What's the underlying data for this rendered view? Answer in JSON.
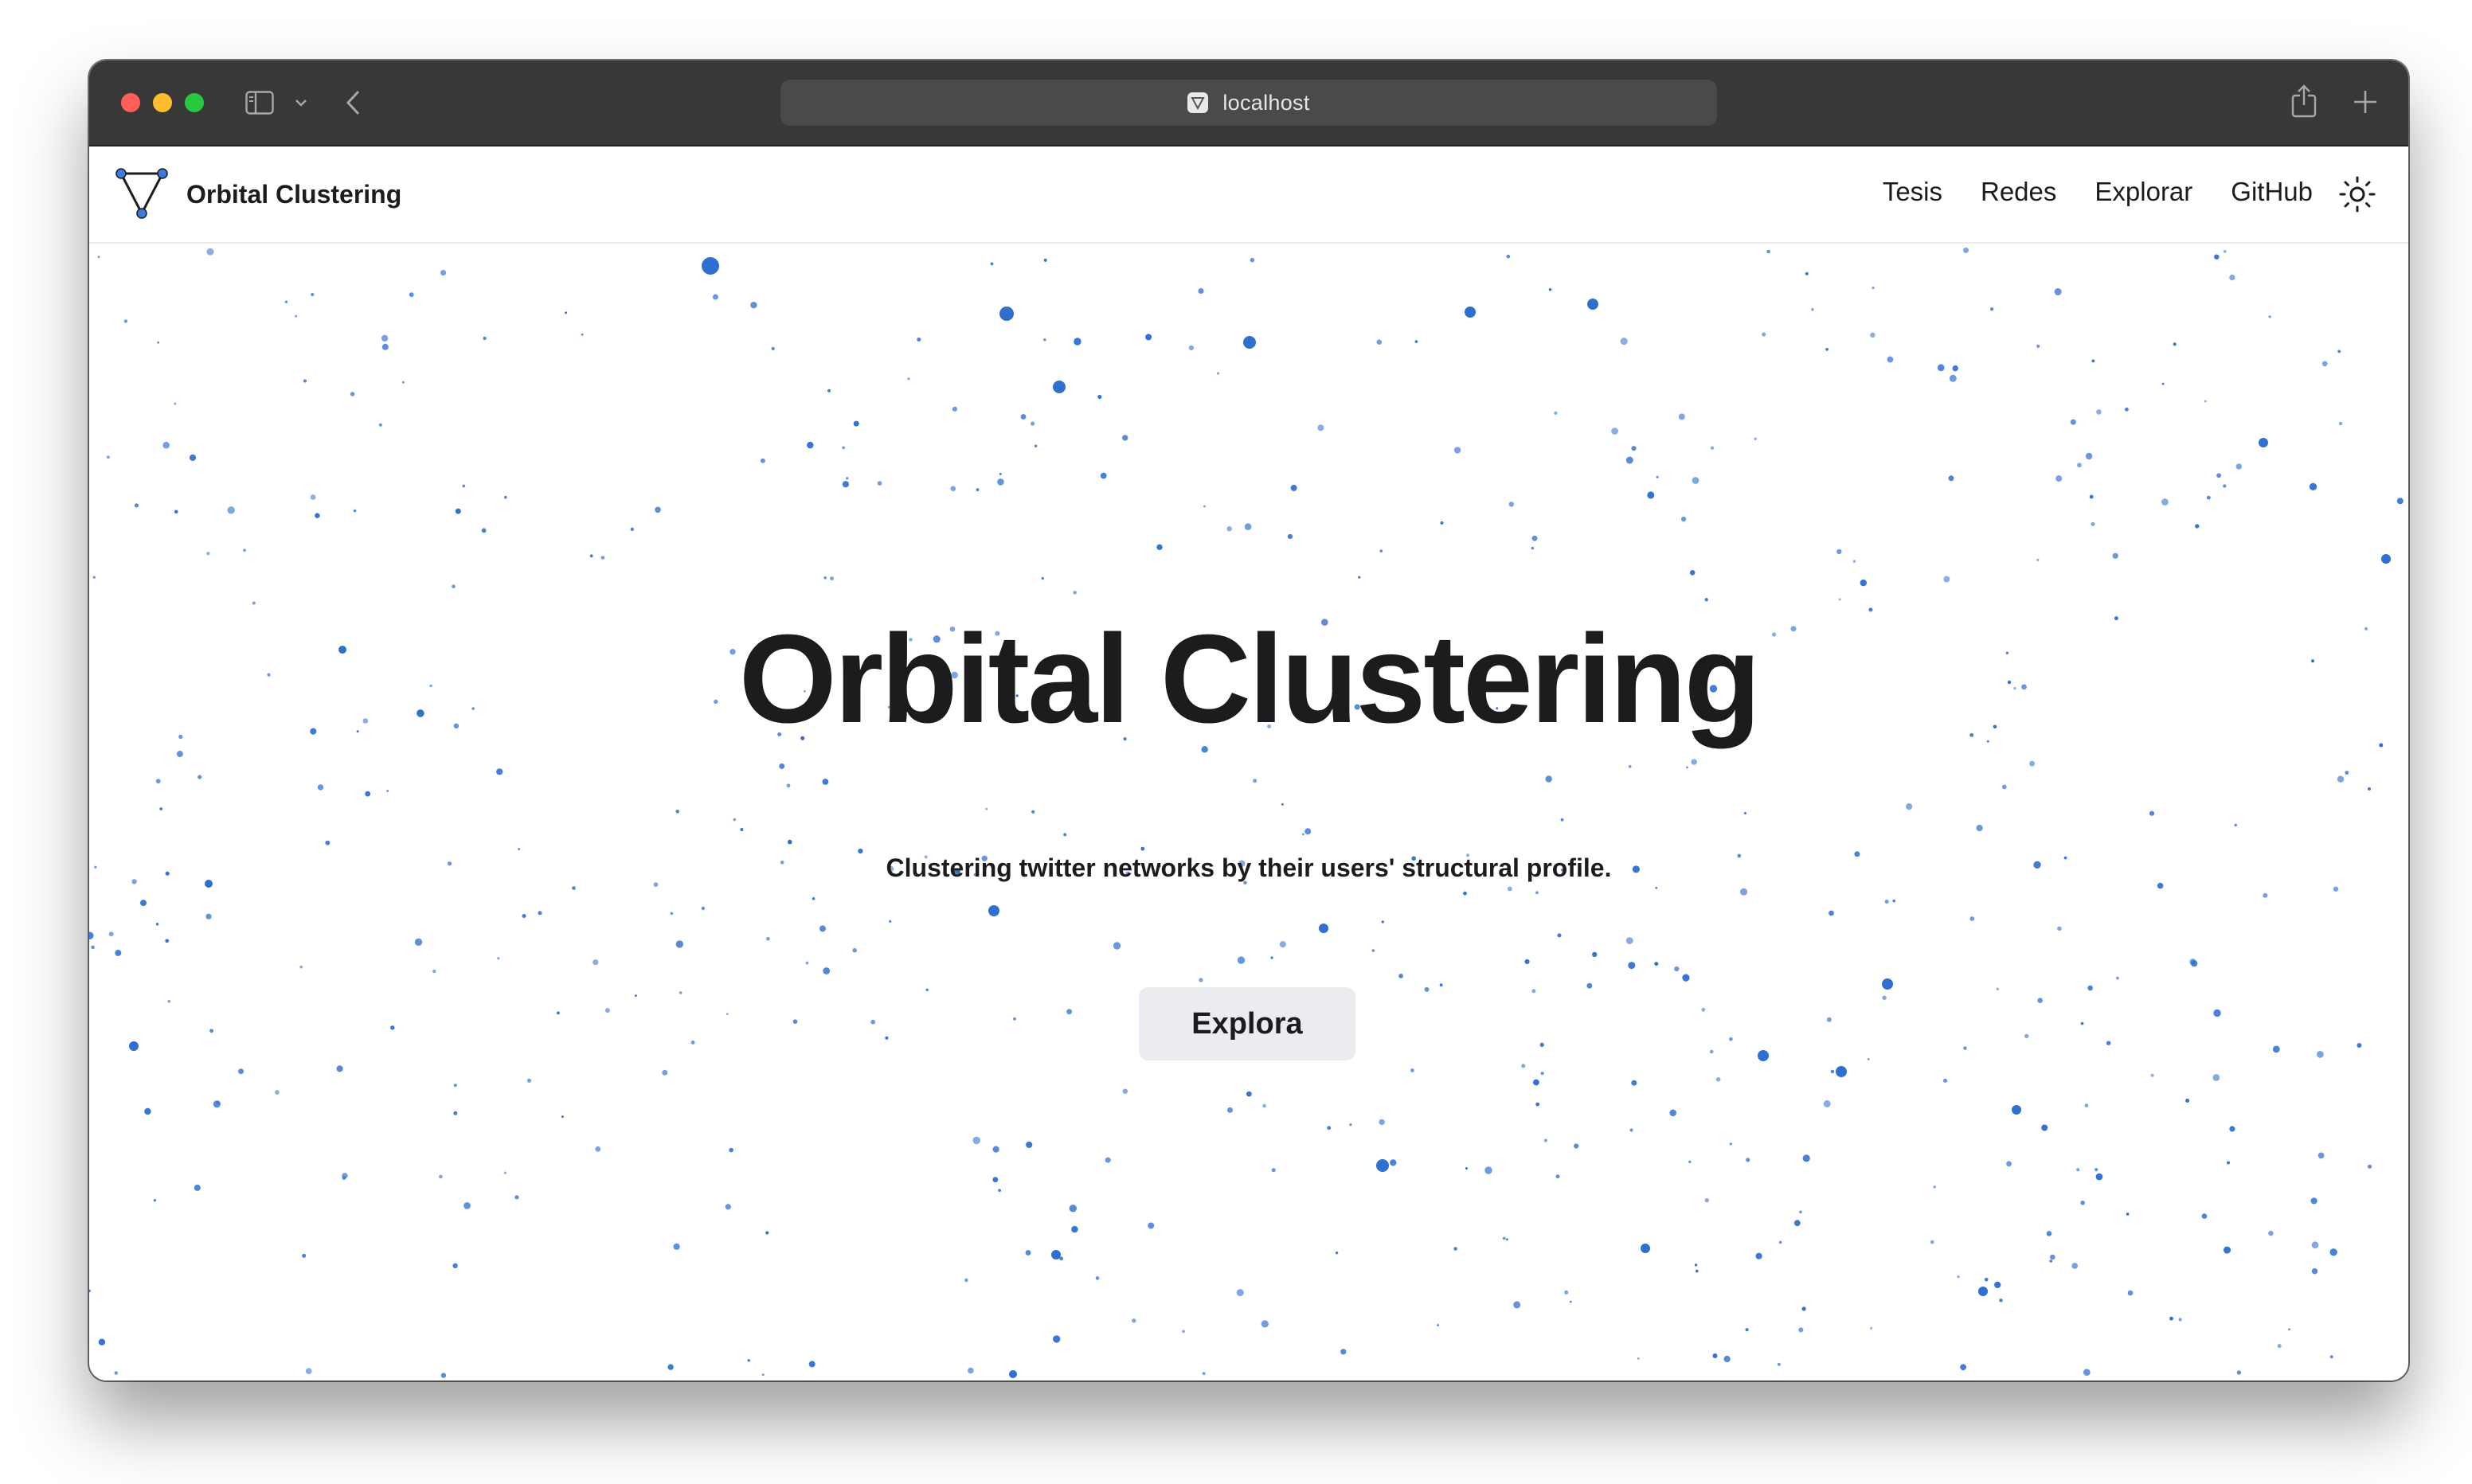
{
  "browser": {
    "url": "localhost"
  },
  "site": {
    "brand": "Orbital Clustering",
    "nav": [
      "Tesis",
      "Redes",
      "Explorar",
      "GitHub"
    ],
    "theme_icon": "sun-icon"
  },
  "hero": {
    "title": "Orbital Clustering",
    "subtitle": "Clustering twitter networks by their users' structural profile.",
    "cta_label": "Explora"
  },
  "colors": {
    "titlebar": "#383838",
    "accent_dots": "#2f6fcf",
    "text": "#1c1c1e",
    "button_bg": "#ebecf0"
  }
}
